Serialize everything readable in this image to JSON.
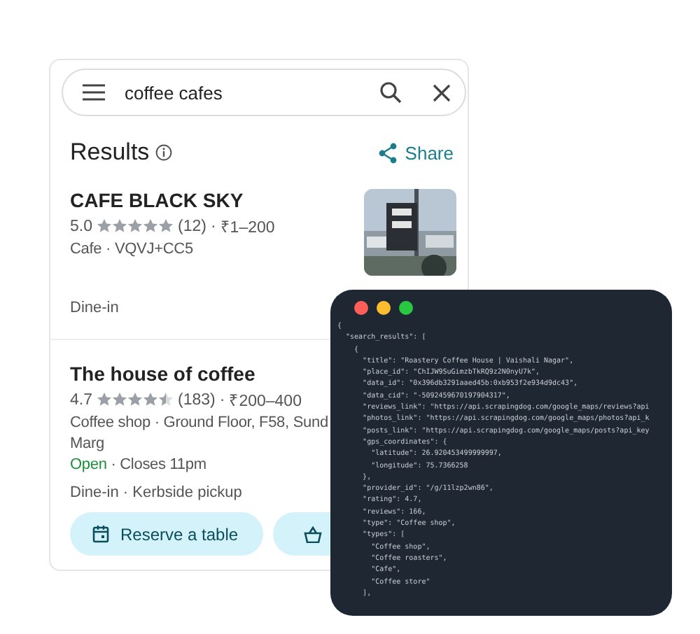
{
  "search": {
    "value": "coffee cafes"
  },
  "results_header": {
    "title": "Results",
    "share": "Share"
  },
  "places": [
    {
      "name": "CAFE BLACK SKY",
      "rating": "5.0",
      "stars": 5,
      "reviews": "(12)",
      "separator": "·",
      "price": "₹1–200",
      "lines": [
        {
          "text": "Cafe · VQVJ+CC5"
        }
      ],
      "services": "Dine-in",
      "has_photo": true
    },
    {
      "name": "The house of coffee",
      "rating": "4.7",
      "stars": 4.5,
      "reviews": "(183)",
      "separator": "·",
      "price": "₹200–400",
      "lines": [
        {
          "text": "Coffee shop · Ground Floor, F58, Sund"
        },
        {
          "text": "Marg"
        }
      ],
      "status": {
        "open": "Open",
        "hours": "· Closes 11pm"
      },
      "services": "Dine-in · Kerbside pickup",
      "has_photo": false,
      "buttons": [
        {
          "kind": "reserve",
          "label": "Reserve a table"
        },
        {
          "kind": "order"
        }
      ]
    }
  ],
  "code_window": {
    "lines": [
      "{",
      "  \"search_results\": [",
      "    {",
      "      \"title\": \"Roastery Coffee House | Vaishali Nagar\",",
      "      \"place_id\": \"ChIJW9SuGimzbTkRQ9z2N0nyU7k\",",
      "      \"data_id\": \"0x396db3291aaed45b:0xb953f2e934d9dc43\",",
      "      \"data_cid\": \"-5092459670197904317\",",
      "      \"reviews_link\": \"https://api.scrapingdog.com/google_maps/reviews?api",
      "      \"photos_link\": \"https://api.scrapingdog.com/google_maps/photos?api_k",
      "      \"posts_link\": \"https://api.scrapingdog.com/google_maps/posts?api_key",
      "      \"gps_coordinates\": {",
      "        \"latitude\": 26.920453499999997,",
      "        \"longitude\": 75.7366258",
      "      },",
      "      \"provider_id\": \"/g/11lzp2wn86\",",
      "      \"rating\": 4.7,",
      "      \"reviews\": 166,",
      "      \"type\": \"Coffee shop\",",
      "      \"types\": [",
      "        \"Coffee shop\",",
      "        \"Coffee roasters\",",
      "        \"Cafe\",",
      "        \"Coffee store\"",
      "      ],"
    ]
  }
}
